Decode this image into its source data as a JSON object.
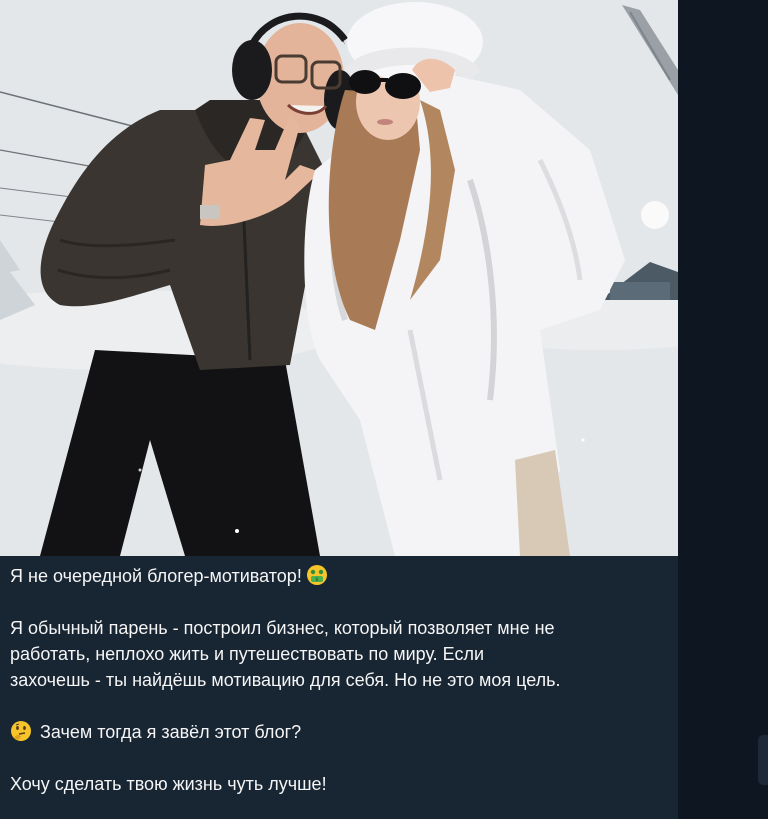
{
  "message": {
    "photo": {
      "alt_icon": "photo-image"
    },
    "caption": {
      "line1": "Я не очередной блогер-мотиватор!",
      "line1_emoji": "money-mouth-face-icon",
      "para2_line1": "Я обычный парень - построил бизнес, который позволяет мне не",
      "para2_line2": "работать, неплохо жить и путешествовать по миру. Если",
      "para2_line3": "захочешь - ты найдёшь мотивацию для себя. Но не это моя цель.",
      "line3_emoji": "thinking-face-icon",
      "line3": "Зачем тогда я завёл этот блог?",
      "line4": "Хочу сделать твою жизнь чуть лучше!"
    }
  },
  "colors": {
    "app_background": "#0e1621",
    "message_background": "#182533",
    "text": "#f5f5f5"
  }
}
